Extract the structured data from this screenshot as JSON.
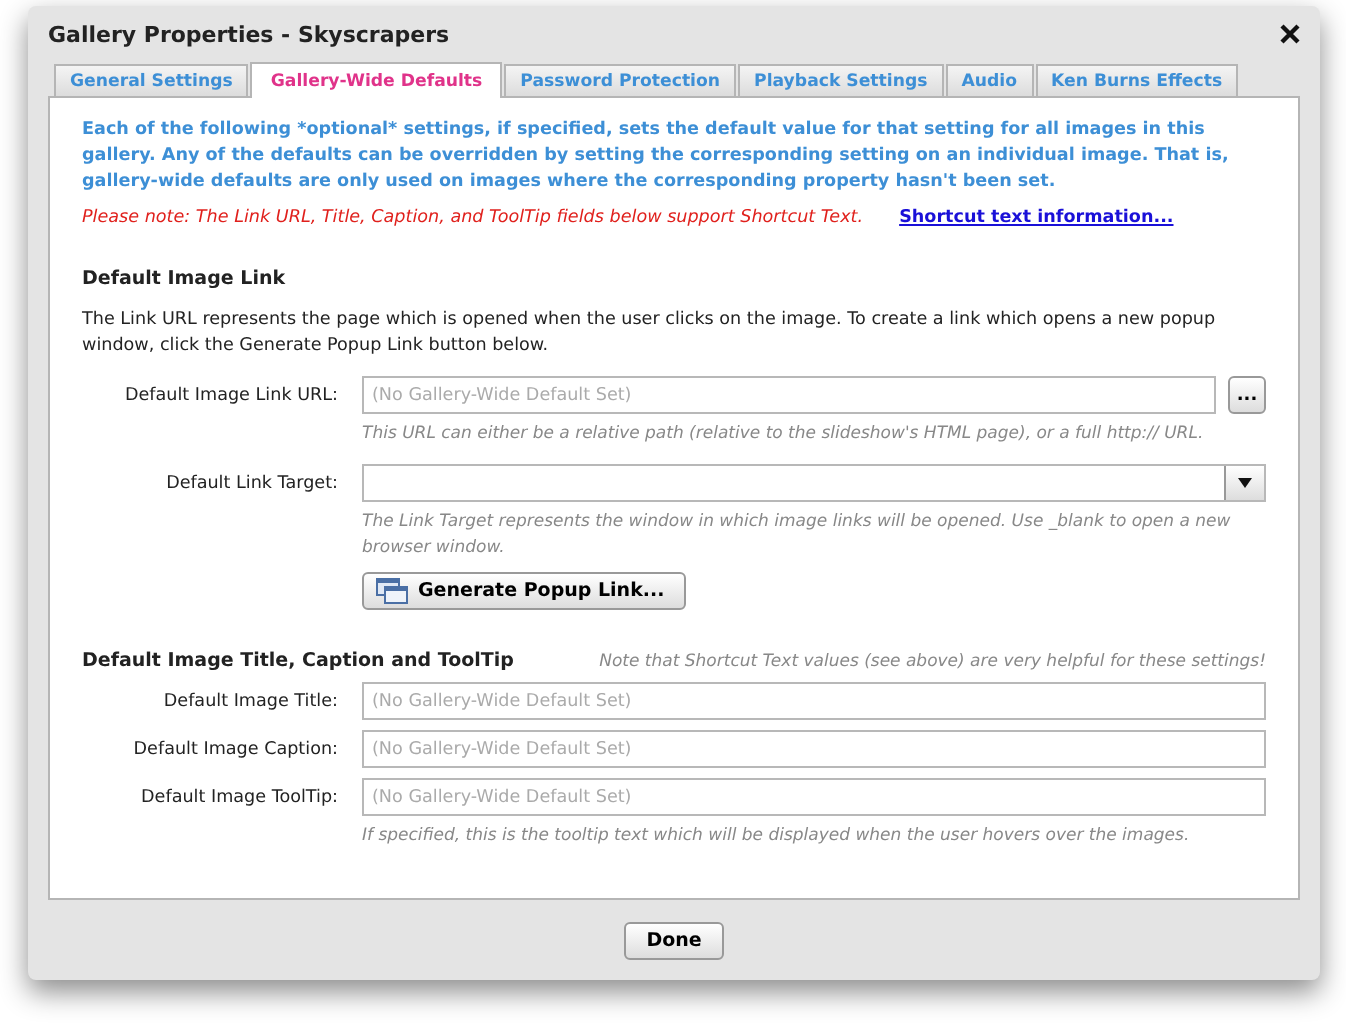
{
  "window": {
    "title": "Gallery Properties - Skyscrapers"
  },
  "tabs": [
    {
      "label": "General Settings",
      "selected": false
    },
    {
      "label": "Gallery-Wide Defaults",
      "selected": true
    },
    {
      "label": "Password Protection",
      "selected": false
    },
    {
      "label": "Playback Settings",
      "selected": false
    },
    {
      "label": "Audio",
      "selected": false
    },
    {
      "label": "Ken Burns Effects",
      "selected": false
    }
  ],
  "intro": "Each of the following *optional* settings, if specified, sets the default value for that setting for all images in this gallery.  Any of the defaults can be overridden by setting the corresponding setting on an individual image.  That is, gallery-wide defaults are only used on images where the corresponding property hasn't been set.",
  "note": {
    "text": "Please note: The Link URL, Title, Caption, and ToolTip fields below support Shortcut Text.",
    "link": "Shortcut text information..."
  },
  "link_section": {
    "heading": "Default Image Link",
    "description": "The Link URL represents the page which is opened when the user clicks on the image.  To create a link which opens a new popup window, click the Generate Popup Link button below.",
    "url_field": {
      "label": "Default Image Link URL:",
      "placeholder": "(No Gallery-Wide Default Set)",
      "browse_button": "...",
      "hint": "This URL can either be a relative path (relative to the slideshow's HTML page), or a full http:// URL."
    },
    "target_field": {
      "label": "Default Link Target:",
      "hint": "The Link Target represents the window in which image links will be opened.  Use _blank to open a new browser window."
    },
    "popup_button": "Generate Popup Link..."
  },
  "title_section": {
    "heading": "Default Image Title, Caption and ToolTip",
    "note": "Note that Shortcut Text values (see above) are very helpful for these settings!",
    "fields": [
      {
        "label": "Default Image Title:",
        "placeholder": "(No Gallery-Wide Default Set)"
      },
      {
        "label": "Default Image Caption:",
        "placeholder": "(No Gallery-Wide Default Set)"
      },
      {
        "label": "Default Image ToolTip:",
        "placeholder": "(No Gallery-Wide Default Set)"
      }
    ],
    "hint": "If specified, this is the tooltip text which will be displayed when the user hovers over the images."
  },
  "done_button": "Done"
}
